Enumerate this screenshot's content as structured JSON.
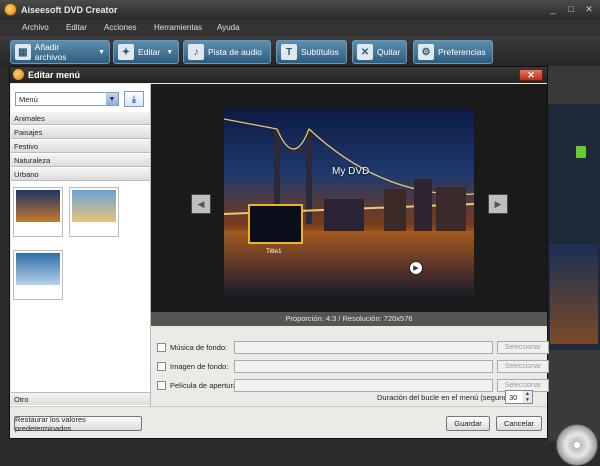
{
  "app": {
    "title": "Aiseesoft DVD Creator",
    "controls": [
      "_",
      "□",
      "✕"
    ]
  },
  "menubar": [
    "Archivo",
    "Editar",
    "Acciones",
    "Herramientas",
    "Ayuda"
  ],
  "toolbar": {
    "add_files": "Añadir archivos",
    "edit": "Editar",
    "audio_track": "Pista de audio",
    "subtitles": "Subtítulos",
    "remove": "Quitar",
    "preferences": "Preferencias"
  },
  "dialog": {
    "title": "Editar menú",
    "close": "✕",
    "menu_select": {
      "value": "Menú"
    },
    "categories": [
      "Animales",
      "Paisajes",
      "Festivo",
      "Naturaleza",
      "Urbano"
    ],
    "other_category": "Otro",
    "preview": {
      "dvd_title": "My DVD",
      "chapter_label": "Title1"
    },
    "info": "Proporción: 4:3 / Resolución: 720x576",
    "options": {
      "background_music": "Música de fondo:",
      "background_image": "Imagen de fondo:",
      "opening_film": "Película de apertura:",
      "select_label": "Seleccionar",
      "loop_label": "Duración del bucle en el menú (segundos):",
      "loop_value": "30"
    },
    "restore_defaults": "Restaurar los valores predeterminados",
    "save": "Guardar",
    "cancel": "Cancelar"
  }
}
